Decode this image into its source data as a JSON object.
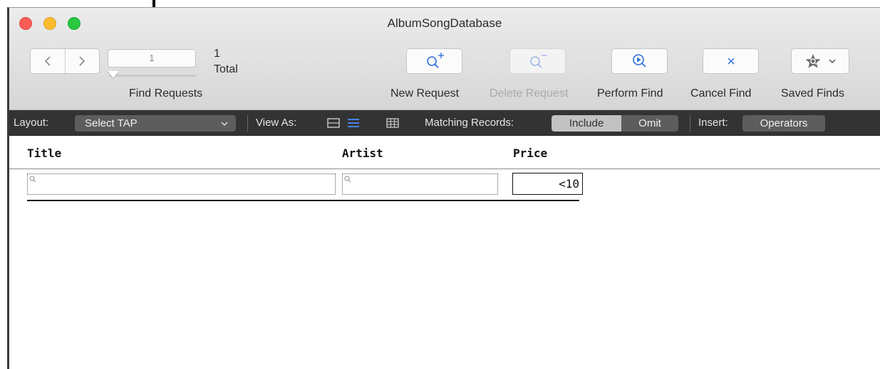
{
  "window": {
    "title": "AlbumSongDatabase"
  },
  "toolbar": {
    "record_current": "1",
    "record_field_value": "1",
    "record_total_label": "Total",
    "find_requests_label": "Find Requests",
    "buttons": [
      {
        "label": "New Request",
        "icon": "magnifier-plus-icon",
        "enabled": true
      },
      {
        "label": "Delete Request",
        "icon": "magnifier-minus-icon",
        "enabled": false
      },
      {
        "label": "Perform Find",
        "icon": "magnifier-play-icon",
        "enabled": true
      },
      {
        "label": "Cancel Find",
        "icon": "close-icon",
        "enabled": true
      },
      {
        "label": "Saved Finds",
        "icon": "star-magnifier-icon",
        "enabled": true
      }
    ]
  },
  "layout_bar": {
    "layout_label": "Layout:",
    "layout_value": "Select TAP",
    "view_as_label": "View As:",
    "matching_label": "Matching Records:",
    "include_label": "Include",
    "omit_label": "Omit",
    "insert_label": "Insert:",
    "operators_label": "Operators"
  },
  "table": {
    "columns": [
      "Title",
      "Artist",
      "Price"
    ],
    "find_row": {
      "title": "",
      "artist": "",
      "price": "<10"
    }
  },
  "colors": {
    "close": "#fc5d57",
    "minimize": "#fdbc2e",
    "maximize": "#2ac840",
    "accent": "#2f6fd8",
    "layout_bar_bg": "#333333"
  }
}
